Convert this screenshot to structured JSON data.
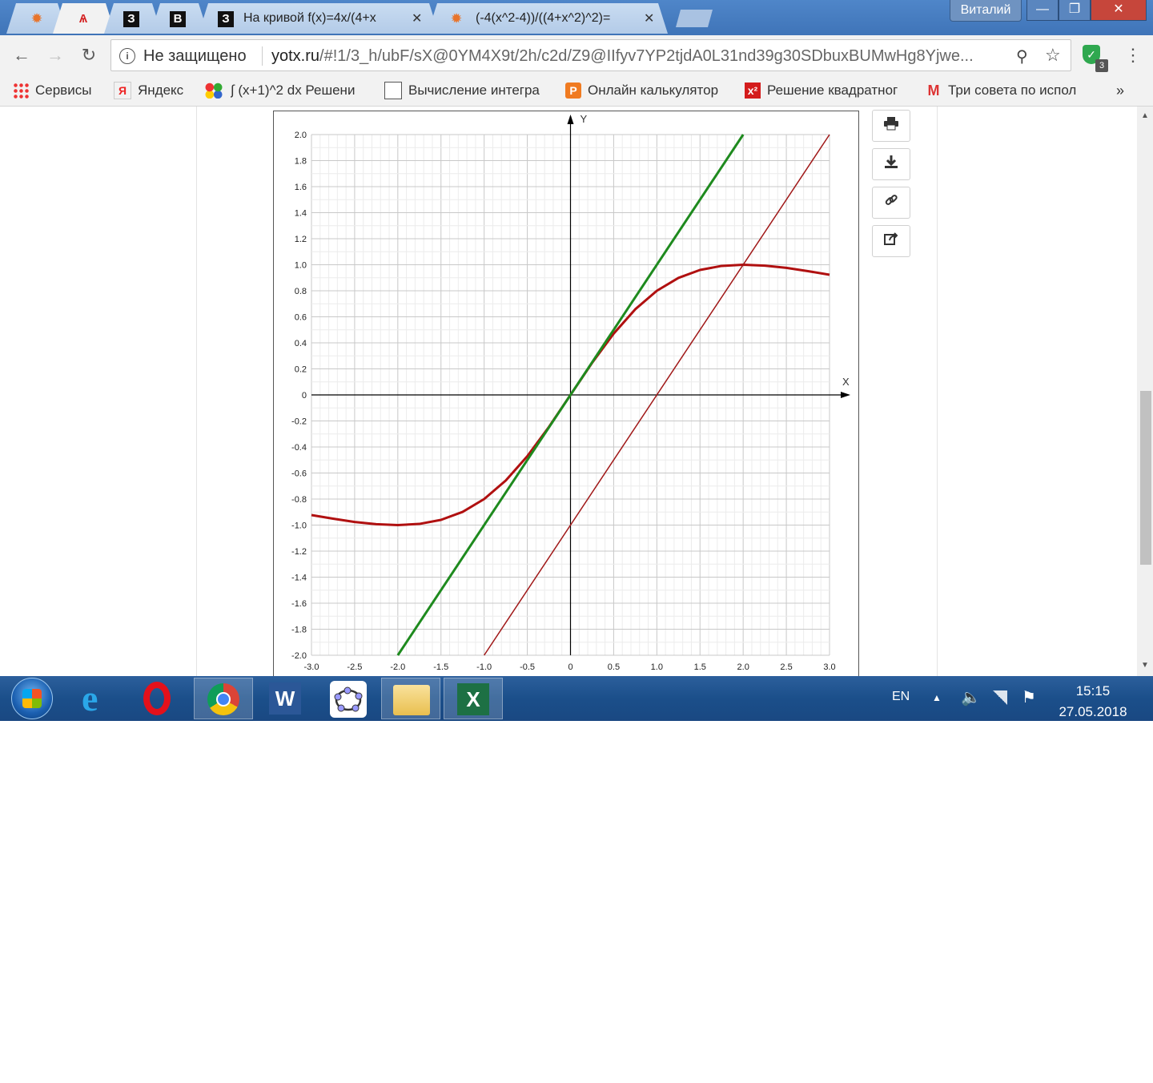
{
  "window": {
    "profile_name": "Виталий",
    "minimize_glyph": "—",
    "restore_glyph": "❐",
    "close_glyph": "✕"
  },
  "tabs": [
    {
      "favicon": "sun-icon",
      "title": "",
      "active": false
    },
    {
      "favicon": "distribution-icon",
      "title": "",
      "active": true
    },
    {
      "favicon": "z-letter-icon",
      "title": "",
      "active": false
    },
    {
      "favicon": "v-letter-icon",
      "title": "",
      "active": false
    },
    {
      "favicon": "z-letter-icon",
      "title": "На кривой f(x)=4x/(4+x",
      "active": false
    },
    {
      "favicon": "sun-icon",
      "title": "(-4(x^2-4))/((4+x^2)^2)=",
      "active": false
    }
  ],
  "toolbar": {
    "security_text": "Не защищено",
    "url_host": "yotx.ru",
    "url_rest": "/#!1/3_h/ubF/sX@0YM4X9t/2h/c2d/Z9@IIfyv7YP2tjdA0L31nd39g30SDbuxBUMwHg8Yjwe...",
    "extension_badge": "3"
  },
  "bookmarks": [
    {
      "icon": "apps-grid-icon",
      "label": "Сервисы"
    },
    {
      "icon": "yandex-icon",
      "label": "Яндекс"
    },
    {
      "icon": "balls-icon",
      "label": "∫ (x+1)^2 dx Решени"
    },
    {
      "icon": "page-icon",
      "label": "Вычисление интегра"
    },
    {
      "icon": "calculator-icon",
      "label": "Онлайн калькулятор"
    },
    {
      "icon": "x-squared-icon",
      "label": "Решение квадратног"
    },
    {
      "icon": "gmail-icon",
      "label": "Три совета по испол"
    }
  ],
  "bookmarks_more": "»",
  "chart_data": {
    "type": "line",
    "xlabel": "X",
    "ylabel": "Y",
    "xlim": [
      -3.0,
      3.0
    ],
    "ylim": [
      -2.0,
      2.0
    ],
    "grid": true,
    "x_ticks": [
      "-3.0",
      "-2.5",
      "-2.0",
      "-1.5",
      "-1.0",
      "-0.5",
      "0",
      "0.5",
      "1.0",
      "1.5",
      "2.0",
      "2.5",
      "3.0"
    ],
    "y_ticks": [
      "2.0",
      "1.8",
      "1.6",
      "1.4",
      "1.2",
      "1.0",
      "0.8",
      "0.6",
      "0.4",
      "0.2",
      "0",
      "-0.2",
      "-0.4",
      "-0.6",
      "-0.8",
      "-1.0",
      "-1.2",
      "-1.4",
      "-1.6",
      "-1.8",
      "-2.0"
    ],
    "series": [
      {
        "color": "#b01010",
        "width": 3,
        "x": [
          -3.0,
          -2.75,
          -2.5,
          -2.25,
          -2.0,
          -1.75,
          -1.5,
          -1.25,
          -1.0,
          -0.75,
          -0.5,
          -0.25,
          0,
          0.25,
          0.5,
          0.75,
          1.0,
          1.25,
          1.5,
          1.75,
          2.0,
          2.25,
          2.5,
          2.75,
          3.0
        ],
        "y": [
          -0.923,
          -0.951,
          -0.976,
          -0.993,
          -1.0,
          -0.991,
          -0.96,
          -0.899,
          -0.8,
          -0.658,
          -0.471,
          -0.246,
          0,
          0.246,
          0.471,
          0.658,
          0.8,
          0.899,
          0.96,
          0.991,
          1.0,
          0.993,
          0.976,
          0.951,
          0.923
        ]
      },
      {
        "color": "#1e8a1e",
        "width": 3,
        "x": [
          -2.0,
          2.0
        ],
        "y": [
          -2.0,
          2.0
        ]
      },
      {
        "color": "#a01818",
        "width": 1.5,
        "x": [
          -1.0,
          3.0
        ],
        "y": [
          -2.0,
          2.0
        ]
      }
    ]
  },
  "side_tools": [
    {
      "icon": "print-icon",
      "glyph": "🖶"
    },
    {
      "icon": "download-icon",
      "glyph": "⤓"
    },
    {
      "icon": "link-icon",
      "glyph": "🔗"
    },
    {
      "icon": "share-icon",
      "glyph": "↪"
    }
  ],
  "taskbar": {
    "lang": "EN",
    "time": "15:15",
    "date": "27.05.2018"
  }
}
